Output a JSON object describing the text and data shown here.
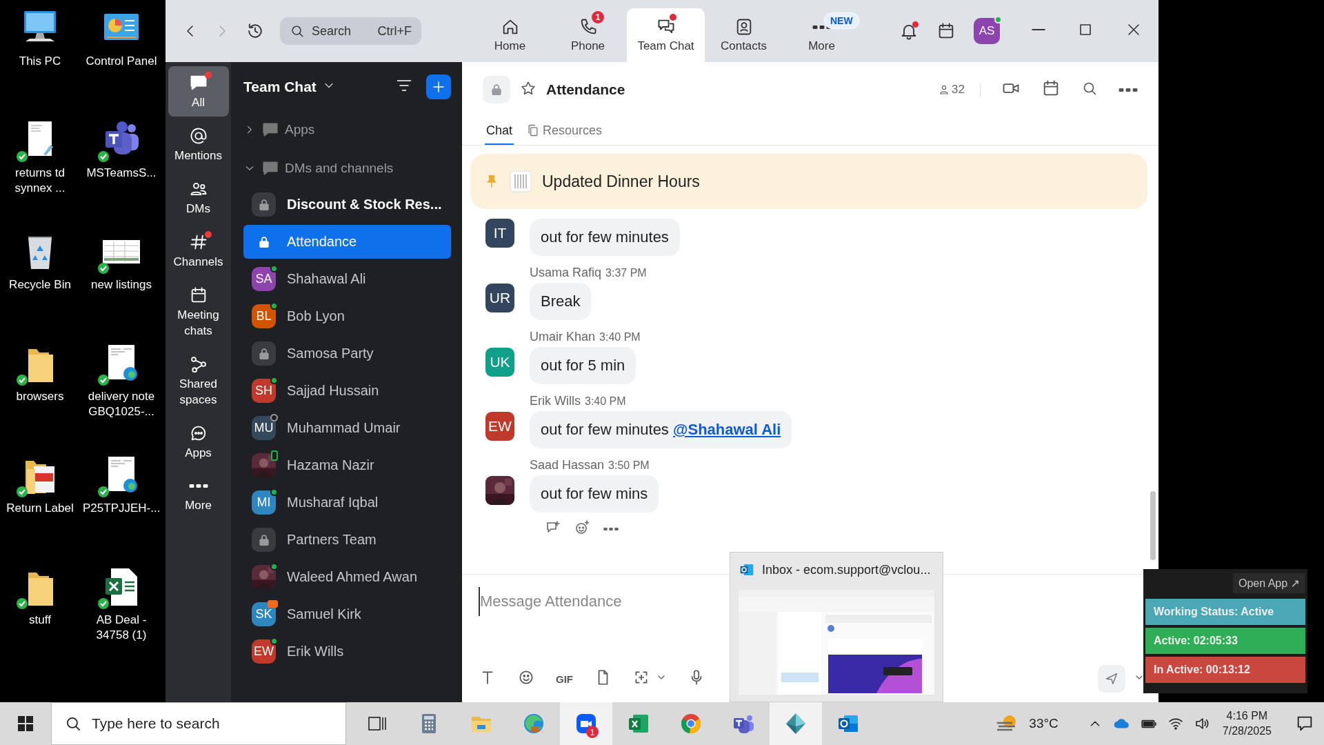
{
  "desktop": {
    "icons": [
      {
        "label": "This PC",
        "kind": "computer",
        "synced": false
      },
      {
        "label": "Control Panel",
        "kind": "control-panel",
        "synced": false
      },
      {
        "label": "returns td synnex ...",
        "kind": "document",
        "synced": true
      },
      {
        "label": "MSTeamsS...",
        "kind": "teams",
        "synced": true
      },
      {
        "label": "Recycle Bin",
        "kind": "recycle-bin",
        "synced": false
      },
      {
        "label": "new listings",
        "kind": "sheet-thumb",
        "synced": true
      },
      {
        "label": "browsers",
        "kind": "folder",
        "synced": true
      },
      {
        "label": "delivery note GBQ1025-...",
        "kind": "edge-doc",
        "synced": true
      },
      {
        "label": "Return Label",
        "kind": "pdf-folder",
        "synced": true
      },
      {
        "label": "P25TPJJEH-...",
        "kind": "edge-doc",
        "synced": true
      },
      {
        "label": "stuff",
        "kind": "folder",
        "synced": true
      },
      {
        "label": "AB Deal - 34758 (1)",
        "kind": "excel",
        "synced": true
      }
    ]
  },
  "toolbar": {
    "search": {
      "placeholder": "Search",
      "shortcut": "Ctrl+F"
    },
    "tabs": [
      {
        "label": "Home",
        "kind": "home",
        "selected": false,
        "unread": false
      },
      {
        "label": "Phone",
        "kind": "phone",
        "selected": false,
        "unread": false,
        "badge": "1"
      },
      {
        "label": "Team Chat",
        "kind": "chat",
        "selected": true,
        "unread": true
      },
      {
        "label": "Contacts",
        "kind": "contacts",
        "selected": false,
        "unread": false
      },
      {
        "label": "More",
        "kind": "more",
        "selected": false,
        "unread": false,
        "tag": "NEW"
      }
    ],
    "notifications_unread": true,
    "avatar": {
      "initials": "AS",
      "presence": {
        "kind": "online"
      }
    }
  },
  "rail": [
    {
      "label": "All",
      "kind": "chat",
      "selected": true,
      "unread": true
    },
    {
      "label": "Mentions",
      "kind": "at",
      "selected": false,
      "unread": false
    },
    {
      "label": "DMs",
      "kind": "people",
      "selected": false,
      "unread": false
    },
    {
      "label": "Channels",
      "kind": "hash",
      "selected": false,
      "unread": true
    },
    {
      "label": "Meeting chats",
      "kind": "calendar",
      "selected": false,
      "unread": false
    },
    {
      "label": "Shared spaces",
      "kind": "share",
      "selected": false,
      "unread": false
    },
    {
      "label": "Apps",
      "kind": "apps",
      "selected": false,
      "unread": false
    },
    {
      "label": "More",
      "kind": "dots",
      "selected": false,
      "unread": false
    }
  ],
  "channel_list": {
    "title": "Team Chat",
    "sections": [
      {
        "label": "Apps",
        "expanded": false
      },
      {
        "label": "DMs and channels",
        "expanded": true
      }
    ],
    "items": [
      {
        "name": "Discount & Stock Res...",
        "kind": "channel",
        "selected": false,
        "unread": true
      },
      {
        "name": "Attendance",
        "kind": "channel",
        "selected": true,
        "unread": false
      },
      {
        "name": "Shahawal Ali",
        "kind": "person",
        "initials": "SA",
        "color": "#8e44ad",
        "presence": {
          "kind": "online"
        },
        "selected": false,
        "unread": false
      },
      {
        "name": "Bob Lyon",
        "kind": "person",
        "initials": "BL",
        "color": "#d35400",
        "presence": {
          "kind": "online"
        },
        "selected": false,
        "unread": false
      },
      {
        "name": "Samosa Party",
        "kind": "channel",
        "selected": false,
        "unread": false
      },
      {
        "name": "Sajjad Hussain",
        "kind": "person",
        "initials": "SH",
        "color": "#c0392b",
        "presence": {
          "kind": "online"
        },
        "selected": false,
        "unread": false
      },
      {
        "name": "Muhammad Umair",
        "kind": "person",
        "initials": "MU",
        "color": "#34495e",
        "presence": {
          "kind": "offline"
        },
        "selected": false,
        "unread": false
      },
      {
        "name": "Hazama Nazir",
        "kind": "photo-person",
        "presence": {
          "kind": "mobile"
        },
        "selected": false,
        "unread": false
      },
      {
        "name": "Musharaf Iqbal",
        "kind": "person",
        "initials": "MI",
        "color": "#2e86c1",
        "presence": {
          "kind": "online"
        },
        "selected": false,
        "unread": false
      },
      {
        "name": "Partners Team",
        "kind": "channel",
        "selected": false,
        "unread": false
      },
      {
        "name": "Waleed Ahmed Awan",
        "kind": "photo-person",
        "presence": {
          "kind": "online"
        },
        "selected": false,
        "unread": false
      },
      {
        "name": "Samuel Kirk",
        "kind": "person",
        "initials": "SK",
        "color": "#2e86c1",
        "presence": {
          "kind": "meeting"
        },
        "selected": false,
        "unread": false
      },
      {
        "name": "Erik Wills",
        "kind": "person",
        "initials": "EW",
        "color": "#c0392b",
        "presence": {
          "kind": "online"
        },
        "selected": false,
        "unread": false
      }
    ]
  },
  "chat": {
    "title": "Attendance",
    "starred": false,
    "members": "32",
    "tabs": [
      {
        "label": "Chat",
        "selected": true
      },
      {
        "label": "Resources",
        "selected": false
      }
    ],
    "pinned": "Updated Dinner Hours",
    "messages": [
      {
        "kind": "initials",
        "initials": "IT",
        "color": "#34465e",
        "text": "out for few minutes"
      },
      {
        "kind": "initials",
        "sender": "Usama Rafiq",
        "time": "3:37 PM",
        "initials": "UR",
        "color": "#34465e",
        "text": "Break"
      },
      {
        "kind": "initials",
        "sender": "Umair Khan",
        "time": "3:40 PM",
        "initials": "UK",
        "color": "#10a08a",
        "text": "out for 5 min"
      },
      {
        "kind": "initials",
        "sender": "Erik Wills",
        "time": "3:40 PM",
        "initials": "EW",
        "color": "#c0392b",
        "text": "out for few minutes",
        "mention": "@Shahawal Ali"
      },
      {
        "sender": "Saad Hassan",
        "time": "3:50 PM",
        "text": "out for few mins"
      }
    ],
    "composer": {
      "placeholder": "Message Attendance",
      "gif_label": "GIF"
    }
  },
  "outlook_preview": {
    "title": "Inbox - ecom.support@vclou..."
  },
  "status_widget": {
    "button": "Open App ↗",
    "rows": [
      {
        "label": "Working Status: Active",
        "color": "#4aa8b4"
      },
      {
        "label": "Active: 02:05:33",
        "color": "#2fae57"
      },
      {
        "label": "In Active: 00:13:12",
        "color": "#c9473e"
      }
    ]
  },
  "taskbar": {
    "search_placeholder": "Type here to search",
    "apps": [
      {
        "kind": "task-view",
        "highlighted": false
      },
      {
        "kind": "calculator",
        "highlighted": false
      },
      {
        "kind": "file-explorer",
        "highlighted": false
      },
      {
        "kind": "edge",
        "highlighted": false
      },
      {
        "kind": "zoom",
        "highlighted": true,
        "badge": "1"
      },
      {
        "kind": "excel",
        "highlighted": false
      },
      {
        "kind": "chrome",
        "highlighted": false
      },
      {
        "kind": "teams",
        "highlighted": false
      },
      {
        "kind": "diamond",
        "highlighted": true
      },
      {
        "kind": "outlook",
        "highlighted": false
      }
    ],
    "weather": "33°C",
    "time": "4:16 PM",
    "date": "7/28/2025"
  }
}
